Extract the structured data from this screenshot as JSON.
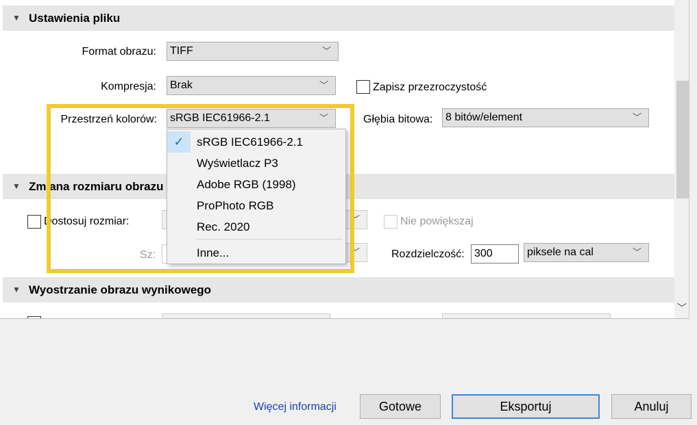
{
  "sections": {
    "file_settings": {
      "title": "Ustawienia pliku"
    },
    "resize": {
      "title": "Zmiana rozmiaru obrazu"
    },
    "sharpen": {
      "title": "Wyostrzanie obrazu wynikowego"
    }
  },
  "file_settings": {
    "format_label": "Format obrazu:",
    "format_value": "TIFF",
    "compression_label": "Kompresja:",
    "compression_value": "Brak",
    "transparency_label": "Zapisz przezroczystość",
    "colorspace_label": "Przestrzeń kolorów:",
    "colorspace_value": "sRGB IEC61966-2.1",
    "bitdepth_label": "Głębia bitowa:",
    "bitdepth_value": "8 bitów/element"
  },
  "colorspace_dropdown": {
    "items": [
      "sRGB IEC61966-2.1",
      "Wyświetlacz P3",
      "Adobe RGB (1998)",
      "ProPhoto RGB",
      "Rec. 2020"
    ],
    "selected": "sRGB IEC61966-2.1",
    "other": "Inne..."
  },
  "resize": {
    "fit_label": "Dostosuj rozmiar:",
    "no_enlarge_label": "Nie powiększaj",
    "width_label": "Sz:",
    "resolution_label": "Rozdzielczość:",
    "resolution_value": "300",
    "resolution_unit": "piksele na cal"
  },
  "footer": {
    "more_info": "Więcej informacji",
    "done": "Gotowe",
    "export": "Eksportuj",
    "cancel": "Anuluj"
  },
  "colors": {
    "highlight": "#f1cc2a",
    "link": "#1a3fb0",
    "primary_border": "#3b86d6"
  }
}
